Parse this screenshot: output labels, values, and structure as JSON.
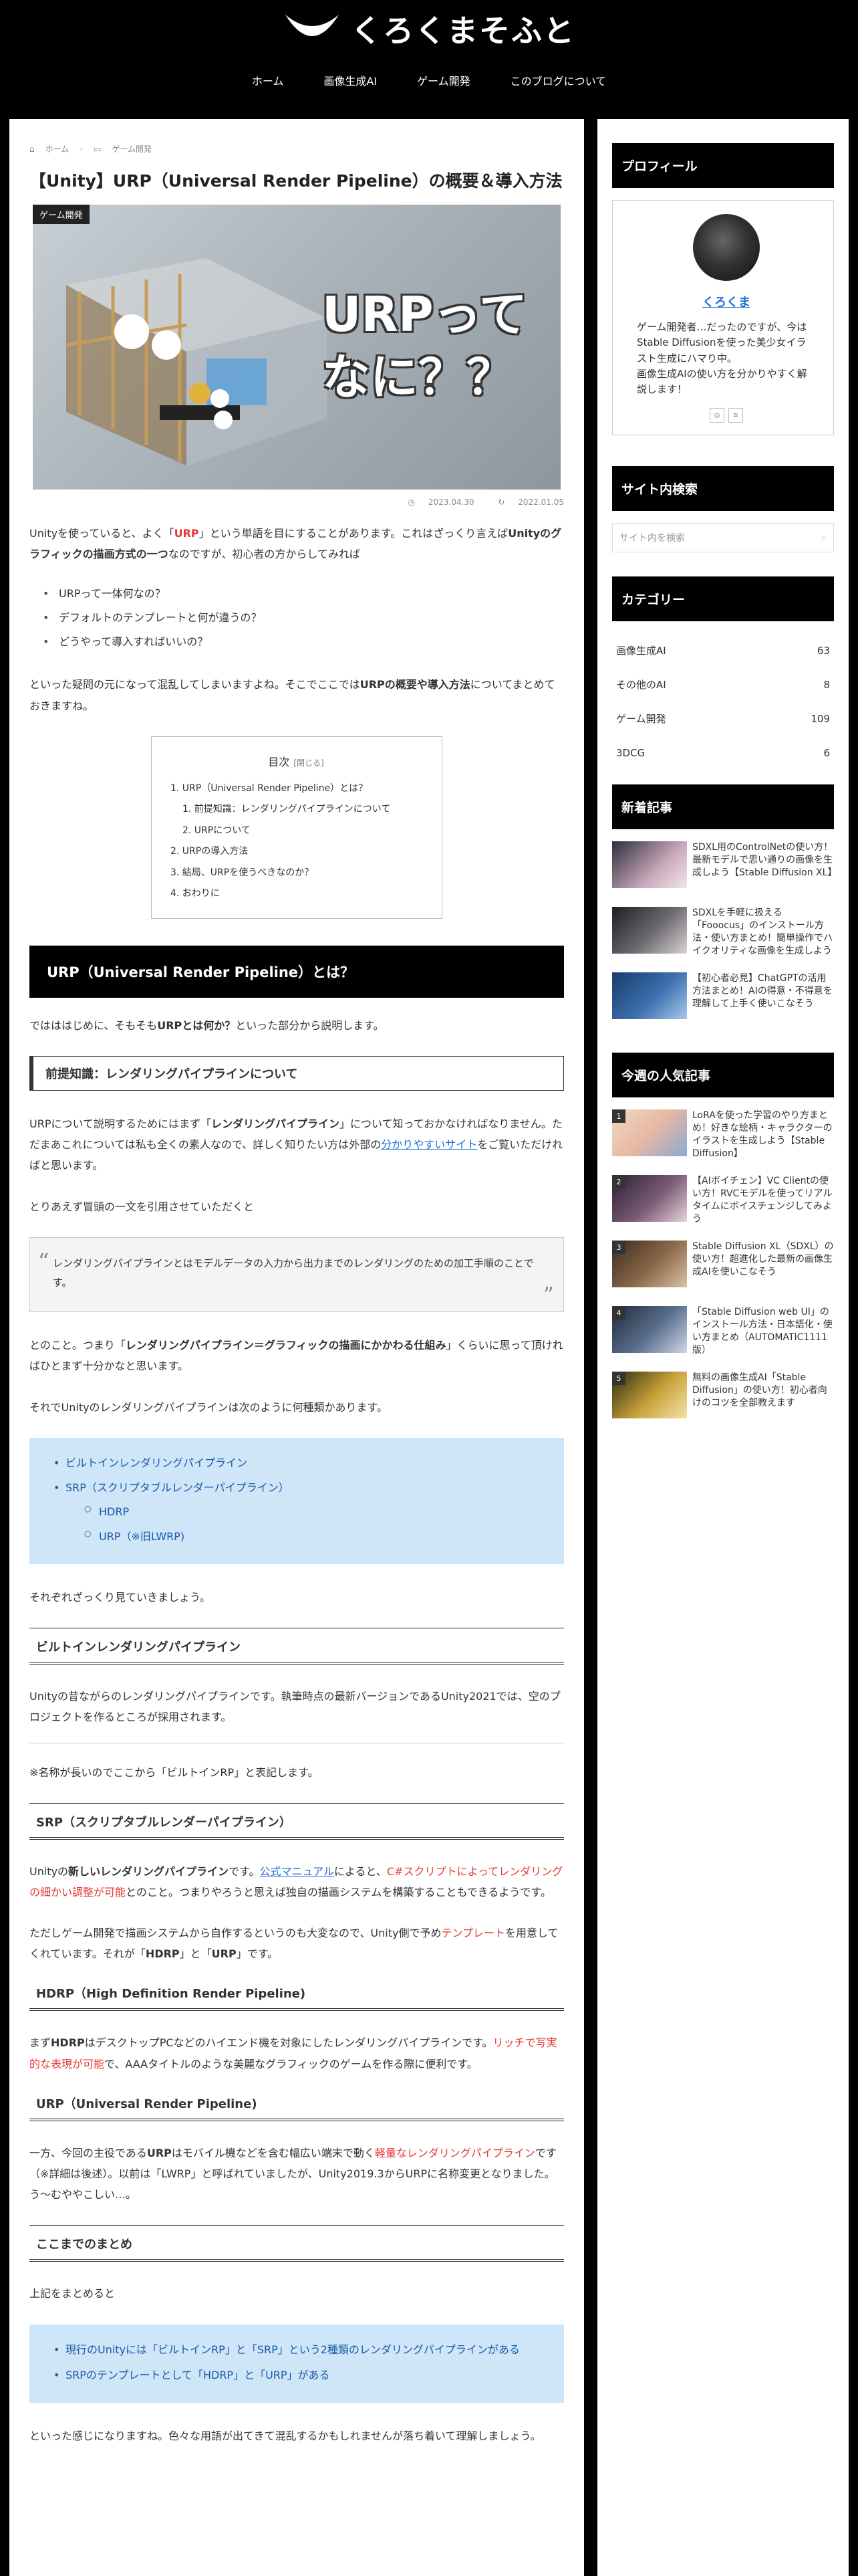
{
  "site": {
    "logo": "くろくまそふと"
  },
  "nav": [
    "ホーム",
    "画像生成AI",
    "ゲーム開発",
    "このブログについて"
  ],
  "breadcrumb": [
    "ホーム",
    "ゲーム開発"
  ],
  "article": {
    "title": "【Unity】URP（Universal Render Pipeline）の概要＆導入方法",
    "category_badge": "ゲーム開発",
    "eyecatch_text": [
      "URPって",
      "なに？？"
    ],
    "published": "2023.04.30",
    "updated": "2022.01.05",
    "intro": {
      "p1_a": "Unityを使っていると、よく「",
      "p1_red": "URP",
      "p1_b": "」という単語を目にすることがあります。これはざっくり言えば",
      "p1_bold": "Unityのグラフィックの描画方式の一つ",
      "p1_c": "なのですが、初心者の方からしてみれば",
      "questions": [
        "URPって一体何なの？",
        "デフォルトのテンプレートと何が違うの？",
        "どうやって導入すればいいの？"
      ],
      "p2_a": "といった疑問の元になって混乱してしまいますよね。そこでここでは",
      "p2_bold": "URPの概要や導入方法",
      "p2_b": "についてまとめておきますね。"
    },
    "toc": {
      "title": "目次",
      "toggle": "[閉じる]",
      "items": [
        "1. URP（Universal Render Pipeline）とは？",
        "1. 前提知識：レンダリングパイプラインについて",
        "2. URPについて",
        "2. URPの導入方法",
        "3. 結局、URPを使うべきなのか？",
        "4. おわりに"
      ]
    },
    "h2_1": "URP（Universal Render Pipeline）とは？",
    "s1_p_a": "ではははじめに、そもそも",
    "s1_p_bold": "URPとは何か？",
    "s1_p_b": "といった部分から説明します。",
    "h3_1": "前提知識：レンダリングパイプラインについて",
    "s2_p1_a": "URPについて説明するためにはまず「",
    "s2_p1_bold": "レンダリングパイプライン",
    "s2_p1_b": "」について知っておかなければなりません。ただまあこれについては私も全くの素人なので、詳しく知りたい方は外部の",
    "s2_p1_link": "分かりやすいサイト",
    "s2_p1_c": "をご覧いただければと思います。",
    "s2_p2": "とりあえず冒頭の一文を引用させていただくと",
    "quote": "レンダリングパイプラインとはモデルデータの入力から出力までのレンダリングのための加工手順のことです。",
    "s2_p3_a": "とのこと。つまり「",
    "s2_p3_bold": "レンダリングパイプライン＝グラフィックの描画にかかわる仕組み",
    "s2_p3_b": "」くらいに思って頂ければひとまず十分かなと思います。",
    "s2_p4": "それでUnityのレンダリングパイプラインは次のように何種類かあります。",
    "pipelines": [
      "ビルトインレンダリングパイプライン",
      "SRP（スクリプタブルレンダーパイプライン）",
      "HDRP",
      "URP（※旧LWRP)"
    ],
    "s2_p5": "それぞれざっくり見ていきましょう。",
    "h4_builtin": "ビルトインレンダリングパイプライン",
    "builtin_p": "Unityの昔ながらのレンダリングパイプラインです。執筆時点の最新バージョンであるUnity2021では、空のプロジェクトを作るところが採用されます。",
    "builtin_note": "※名称が長いのでここから「ビルトインRP」と表記します。",
    "h4_srp": "SRP（スクリプタブルレンダーパイプライン）",
    "srp_p1_a": "Unityの",
    "srp_p1_bold": "新しいレンダリングパイプライン",
    "srp_p1_b": "です。",
    "srp_p1_link": "公式マニュアル",
    "srp_p1_c": "によると、",
    "srp_p1_red": "C#スクリプトによってレンダリングの細かい調整が可能",
    "srp_p1_d": "とのこと。つまりやろうと思えば独自の描画システムを構築することもできるようです。",
    "srp_p2_a": "ただしゲーム開発で描画システムから自作するというのも大変なので、Unity側で予め",
    "srp_p2_red": "テンプレート",
    "srp_p2_b": "を用意してくれています。それが「",
    "srp_p2_bold1": "HDRP",
    "srp_p2_c": "」と「",
    "srp_p2_bold2": "URP",
    "srp_p2_d": "」です。",
    "h4_hdrp": "HDRP（High Definition Render Pipeline)",
    "hdrp_p_a": "まず",
    "hdrp_p_bold": "HDRP",
    "hdrp_p_b": "はデスクトップPCなどのハイエンド機を対象にしたレンダリングパイプラインです。",
    "hdrp_p_red": "リッチで写実的な表現が可能",
    "hdrp_p_c": "で、AAAタイトルのような美麗なグラフィックのゲームを作る際に便利です。",
    "h4_urp": "URP（Universal Render Pipeline)",
    "urp_p_a": "一方、今回の主役である",
    "urp_p_bold": "URP",
    "urp_p_b": "はモバイル機などを含む幅広い端末で動く",
    "urp_p_red": "軽量なレンダリングパイプライン",
    "urp_p_c": "です（※詳細は後述）。以前は「LWRP」と呼ばれていましたが、Unity2019.3からURPに名称変更となりました。う〜むややこしい…。",
    "h4_summary": "ここまでのまとめ",
    "summary_p": "上記をまとめると",
    "summary_items": [
      "現行のUnityには「ビルトインRP」と「SRP」という2種類のレンダリングパイプラインがある",
      "SRPのテンプレートとして「HDRP」と「URP」がある"
    ],
    "closing": "といった感じになりますね。色々な用語が出てきて混乱するかもしれませんが落ち着いて理解しましょう。"
  },
  "sidebar": {
    "profile_title": "プロフィール",
    "profile_name": "くろくま",
    "profile_desc": "ゲーム開発者…だったのですが、今はStable Diffusionを使った美少女イラスト生成にハマり中。\n画像生成AIの使い方を分かりやすく解説します！",
    "search_title": "サイト内検索",
    "search_placeholder": "サイト内を検索",
    "category_title": "カテゴリー",
    "categories": [
      {
        "name": "画像生成AI",
        "count": "63"
      },
      {
        "name": "その他のAI",
        "count": "8"
      },
      {
        "name": "ゲーム開発",
        "count": "109"
      },
      {
        "name": "3DCG",
        "count": "6"
      }
    ],
    "new_title": "新着記事",
    "new_posts": [
      "SDXL用のControlNetの使い方！最新モデルで思い通りの画像を生成しよう【Stable Diffusion XL】",
      "SDXLを手軽に扱える「Fooocus」のインストール方法・使い方まとめ！簡単操作でハイクオリティな画像を生成しよう",
      "【初心者必見】ChatGPTの活用方法まとめ！AIの得意・不得意を理解して上手く使いこなそう"
    ],
    "popular_title": "今週の人気記事",
    "popular_posts": [
      {
        "rank": "1",
        "title": "LoRAを使った学習のやり方まとめ！好きな絵柄・キャラクターのイラストを生成しよう【Stable Diffusion】"
      },
      {
        "rank": "2",
        "title": "【AIボイチェン】VC Clientの使い方！RVCモデルを使ってリアルタイムにボイスチェンジしてみよう"
      },
      {
        "rank": "3",
        "title": "Stable Diffusion XL（SDXL）の使い方！超進化した最新の画像生成AIを使いこなそう"
      },
      {
        "rank": "4",
        "title": "「Stable Diffusion web UI」のインストール方法・日本語化・使い方まとめ（AUTOMATIC1111版）"
      },
      {
        "rank": "5",
        "title": "無料の画像生成AI「Stable Diffusion」の使い方！初心者向けのコツを全部教えます"
      }
    ]
  },
  "colors": {
    "accent_red": "#e53935",
    "link_blue": "#1a6ed8",
    "box_blue": "#cfe5f8",
    "header_bg": "#000000"
  }
}
